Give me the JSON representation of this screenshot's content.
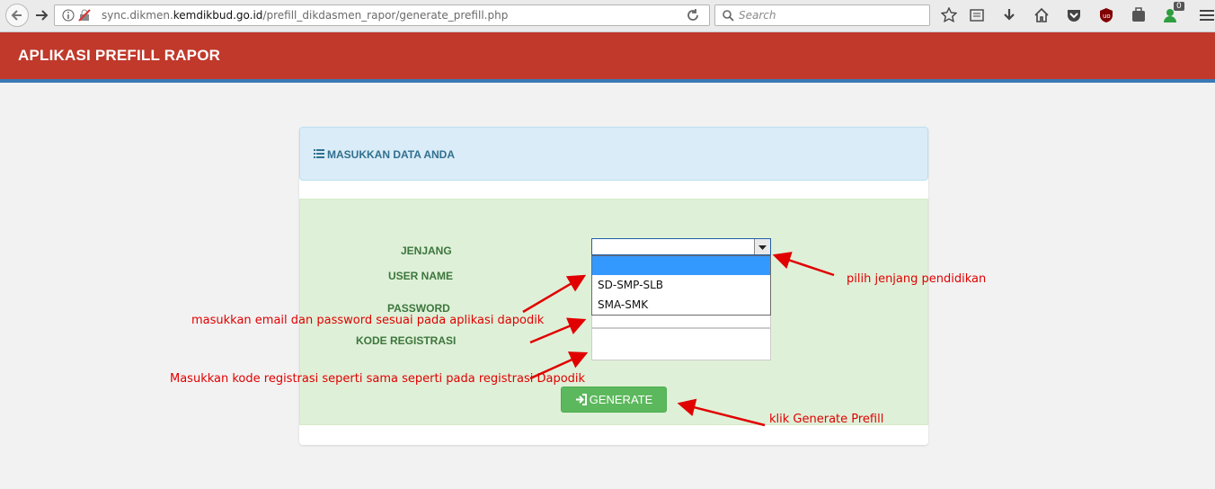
{
  "browser": {
    "url_prefix": "sync.dikmen.",
    "url_domain": "kemdikbud.go.id",
    "url_path": "/prefill_dikdasmen_rapor/generate_prefill.php",
    "search_placeholder": "Search",
    "badge_count": "0"
  },
  "app": {
    "title": "APLIKASI PREFILL RAPOR"
  },
  "panel": {
    "heading": "MASUKKAN DATA ANDA"
  },
  "form": {
    "labels": {
      "jenjang": "JENJANG",
      "username": "USER NAME",
      "password": "PASSWORD",
      "kode": "KODE REGISTRASI"
    },
    "jenjang_options": [
      "",
      "SD-SMP-SLB",
      "SMA-SMK"
    ],
    "generate_label": "GENERATE"
  },
  "annotations": {
    "jenjang_note": "pilih jenjang pendidikan",
    "login_note": "masukkan email dan password sesuai pada aplikasi dapodik",
    "kode_note": "Masukkan kode registrasi seperti sama seperti pada registrasi Dapodik",
    "generate_note": "klik Generate Prefill"
  },
  "colors": {
    "header": "#c0392b",
    "header_border": "#3a78b5",
    "panel_heading": "#d9ecf7",
    "form_bg": "#dff0d8",
    "label": "#3c763d",
    "button": "#5cb85c",
    "annotation": "#e00000",
    "option_selected": "#3399ff"
  }
}
